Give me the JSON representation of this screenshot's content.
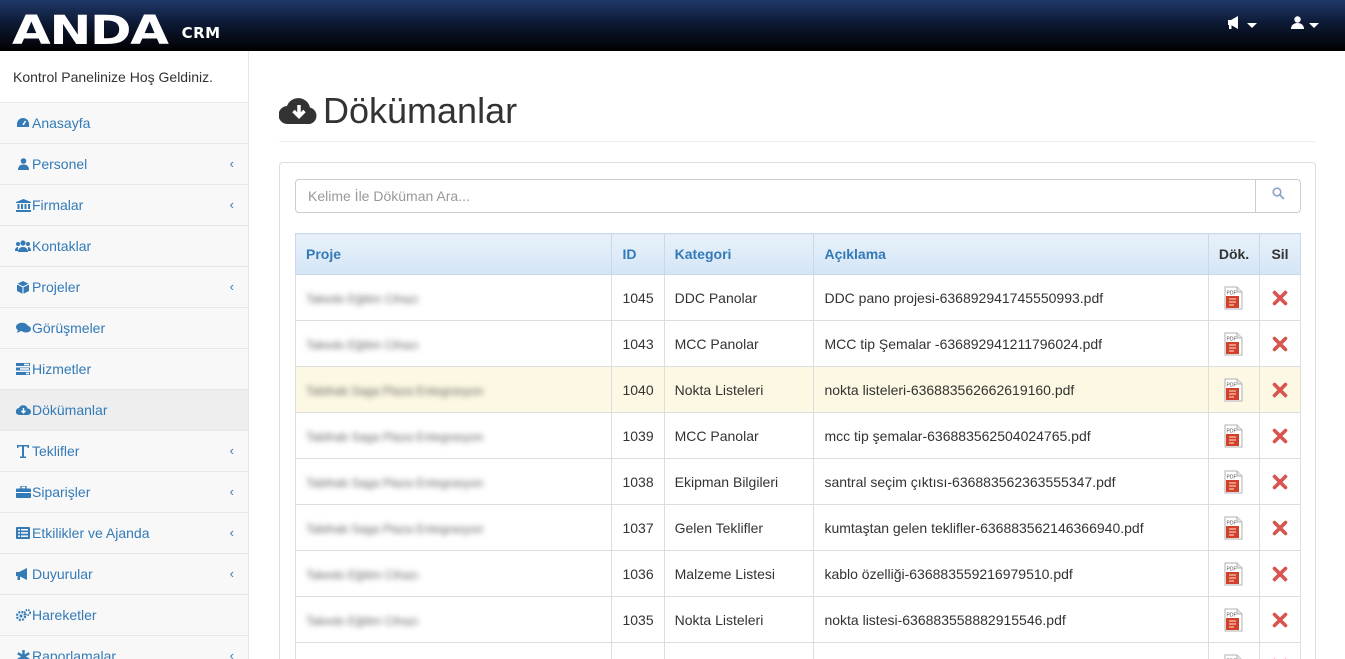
{
  "navbar": {
    "brand": "ANDA",
    "brand_sub": "CRM",
    "icons": [
      "megaphone-icon",
      "user-icon"
    ]
  },
  "sidebar": {
    "welcome": "Kontrol Panelinize Hoş Geldiniz.",
    "items": [
      {
        "label": "Anasayfa",
        "icon": "dashboard-icon",
        "has_sub": false
      },
      {
        "label": "Personel",
        "icon": "user-icon",
        "has_sub": true
      },
      {
        "label": "Firmalar",
        "icon": "bank-icon",
        "has_sub": true
      },
      {
        "label": "Kontaklar",
        "icon": "users-icon",
        "has_sub": false
      },
      {
        "label": "Projeler",
        "icon": "cube-icon",
        "has_sub": true
      },
      {
        "label": "Görüşmeler",
        "icon": "comments-icon",
        "has_sub": false
      },
      {
        "label": "Hizmetler",
        "icon": "tasks-icon",
        "has_sub": false
      },
      {
        "label": "Dökümanlar",
        "icon": "cloud-download-icon",
        "has_sub": false,
        "active": true
      },
      {
        "label": "Teklifler",
        "icon": "text-icon",
        "has_sub": true
      },
      {
        "label": "Siparişler",
        "icon": "briefcase-icon",
        "has_sub": true
      },
      {
        "label": "Etkilikler ve Ajanda",
        "icon": "list-icon",
        "has_sub": true
      },
      {
        "label": "Duyurular",
        "icon": "bullhorn-icon",
        "has_sub": true
      },
      {
        "label": "Hareketler",
        "icon": "cogs-icon",
        "has_sub": false
      },
      {
        "label": "Raporlamalar",
        "icon": "asterisk-icon",
        "has_sub": true
      }
    ]
  },
  "page": {
    "title": "Dökümanlar",
    "search_placeholder": "Kelime İle Döküman Ara..."
  },
  "table": {
    "headers": [
      "Proje",
      "ID",
      "Kategori",
      "Açıklama",
      "Dök.",
      "Sil"
    ],
    "rows": [
      {
        "proje": "Takedo Eğitim Cihazı",
        "id": "1045",
        "kategori": "DDC Panolar",
        "aciklama": "DDC pano projesi-636892941745550993.pdf"
      },
      {
        "proje": "Takedo Eğitim Cihazı",
        "id": "1043",
        "kategori": "MCC Panolar",
        "aciklama": "MCC tip Şemalar -636892941211796024.pdf"
      },
      {
        "proje": "Tabihab Saga Plaza Entegrasyon",
        "id": "1040",
        "kategori": "Nokta Listeleri",
        "aciklama": "nokta listeleri-636883562662619160.pdf",
        "highlight": true
      },
      {
        "proje": "Tabihab Saga Plaza Entegrasyon",
        "id": "1039",
        "kategori": "MCC Panolar",
        "aciklama": "mcc tip şemalar-636883562504024765.pdf"
      },
      {
        "proje": "Tabihab Saga Plaza Entegrasyon",
        "id": "1038",
        "kategori": "Ekipman Bilgileri",
        "aciklama": "santral seçim çıktısı-636883562363555347.pdf"
      },
      {
        "proje": "Tabihab Saga Plaza Entegrasyon",
        "id": "1037",
        "kategori": "Gelen Teklifler",
        "aciklama": "kumtaştan gelen teklifler-636883562146366940.pdf"
      },
      {
        "proje": "Takedo Eğitim Cihazı",
        "id": "1036",
        "kategori": "Malzeme Listesi",
        "aciklama": "kablo özelliği-636883559216979510.pdf"
      },
      {
        "proje": "Takedo Eğitim Cihazı",
        "id": "1035",
        "kategori": "Nokta Listeleri",
        "aciklama": "nokta listesi-636883558882915546.pdf"
      },
      {
        "proje": "",
        "id": "",
        "kategori": "",
        "aciklama": ""
      }
    ]
  },
  "colors": {
    "link": "#337ab7",
    "delete": "#d9534f",
    "highlight_row": "#fcf8e3"
  }
}
